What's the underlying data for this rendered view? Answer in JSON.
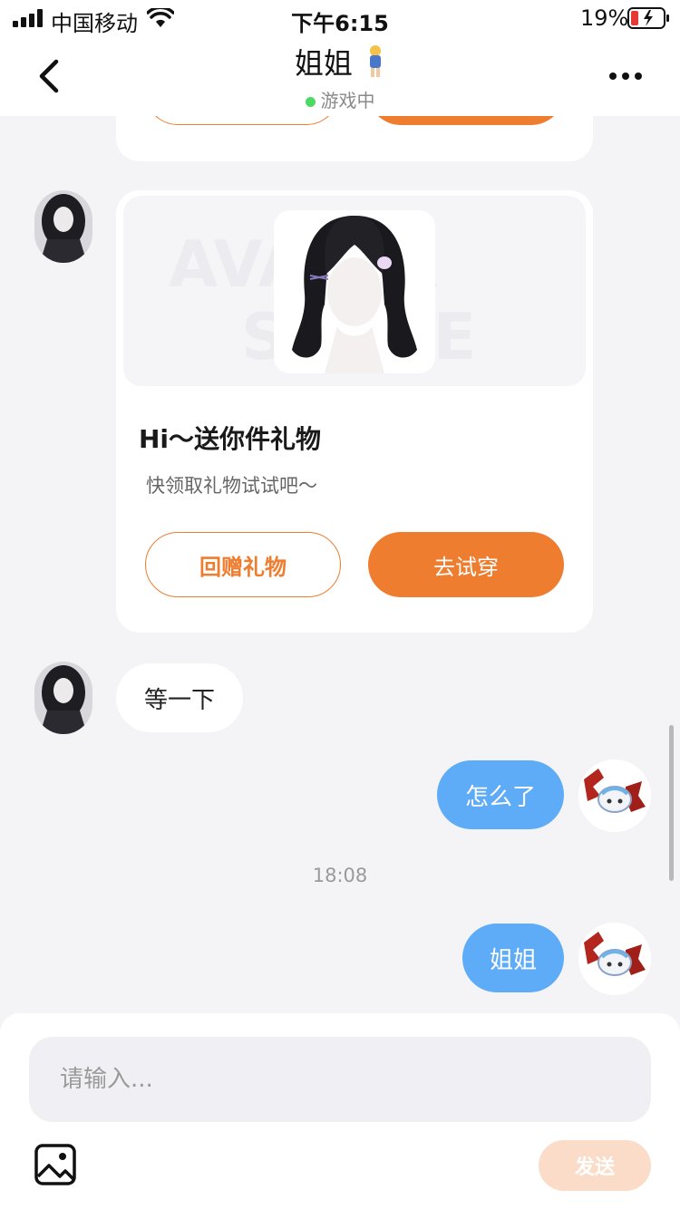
{
  "status_bar": {
    "carrier": "中国移动",
    "time": "下午6:15",
    "battery": "19%"
  },
  "nav": {
    "title": "姐姐",
    "status": "游戏中"
  },
  "gift_card": {
    "title": "Hi～送你件礼物",
    "subtitle": "快领取礼物试试吧～",
    "return_gift_label": "回赠礼物",
    "try_on_label": "去试穿"
  },
  "messages": [
    {
      "sender": "other",
      "text": "等一下"
    },
    {
      "sender": "self",
      "text": "怎么了"
    },
    {
      "sender": "self",
      "text": "姐姐"
    }
  ],
  "timestamp": "18:08",
  "composer": {
    "placeholder": "请输入...",
    "send_label": "发送"
  },
  "colors": {
    "accent": "#ee7d30",
    "bubble_blue": "#5eabf7",
    "online": "#4cd964",
    "background": "#f4f4f7"
  },
  "icons": {
    "back": "chevron-left-icon",
    "more": "more-dots-icon",
    "image": "image-icon"
  }
}
